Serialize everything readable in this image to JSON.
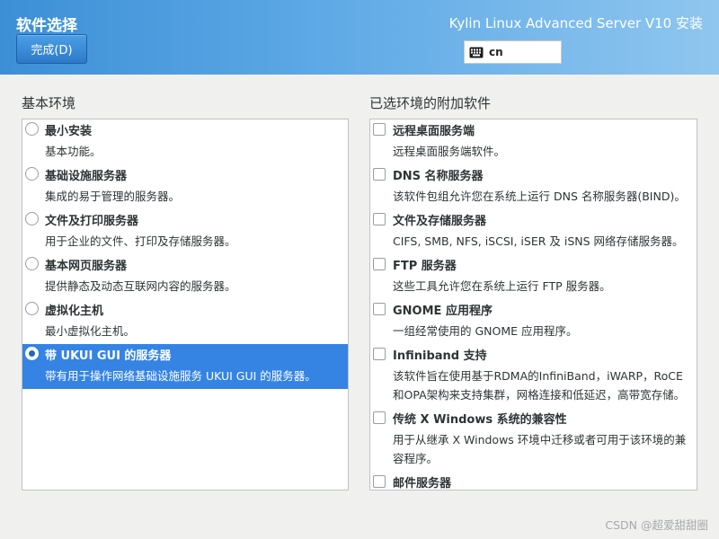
{
  "header": {
    "title": "软件选择",
    "done_label": "完成(D)",
    "product": "Kylin Linux Advanced Server V10 安装",
    "keyboard_layout": "cn"
  },
  "base_env": {
    "title": "基本环境",
    "items": [
      {
        "name": "最小安装",
        "desc": "基本功能。",
        "selected": false
      },
      {
        "name": "基础设施服务器",
        "desc": "集成的易于管理的服务器。",
        "selected": false
      },
      {
        "name": "文件及打印服务器",
        "desc": "用于企业的文件、打印及存储服务器。",
        "selected": false
      },
      {
        "name": "基本网页服务器",
        "desc": "提供静态及动态互联网内容的服务器。",
        "selected": false
      },
      {
        "name": "虚拟化主机",
        "desc": "最小虚拟化主机。",
        "selected": false
      },
      {
        "name": "带 UKUI GUI 的服务器",
        "desc": "带有用于操作网络基础设施服务 UKUI GUI 的服务器。",
        "selected": true
      }
    ]
  },
  "addons": {
    "title": "已选环境的附加软件",
    "items": [
      {
        "name": "远程桌面服务端",
        "desc": "远程桌面服务端软件。"
      },
      {
        "name": "DNS 名称服务器",
        "desc": "该软件包组允许您在系统上运行 DNS 名称服务器(BIND)。"
      },
      {
        "name": "文件及存储服务器",
        "desc": "CIFS, SMB, NFS, iSCSI, iSER 及 iSNS 网络存储服务器。"
      },
      {
        "name": "FTP 服务器",
        "desc": "这些工具允许您在系统上运行 FTP 服务器。"
      },
      {
        "name": "GNOME 应用程序",
        "desc": "一组经常使用的 GNOME 应用程序。"
      },
      {
        "name": "Infiniband 支持",
        "desc": "该软件旨在使用基于RDMA的InfiniBand，iWARP，RoCE和OPA架构来支持集群，网格连接和低延迟，高带宽存储。"
      },
      {
        "name": "传统 X Windows 系统的兼容性",
        "desc": "用于从继承 X Windows 环境中迁移或者可用于该环境的兼容程序。"
      },
      {
        "name": "邮件服务器",
        "desc": ""
      }
    ]
  },
  "watermark": "CSDN @超爱甜甜圈",
  "colors": {
    "header_start": "#3c8fd6",
    "header_end": "#8fc6ef",
    "selection": "#3584e4"
  }
}
